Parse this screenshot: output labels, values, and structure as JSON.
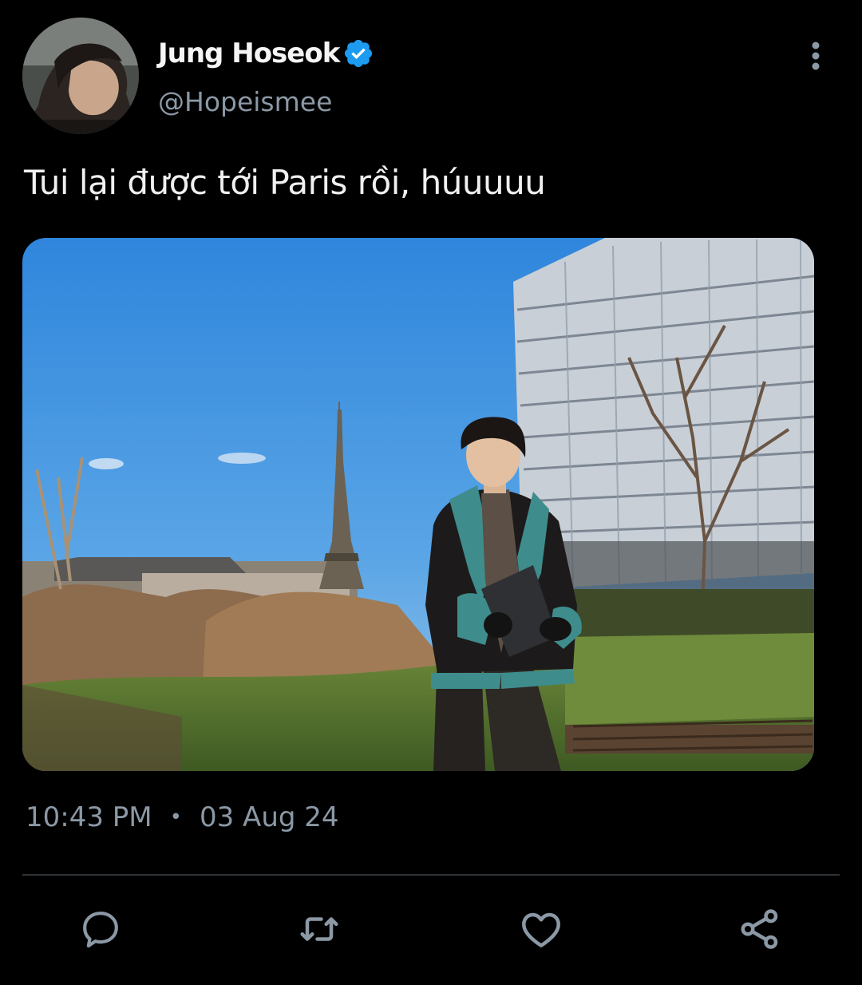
{
  "author": {
    "display_name": "Jung Hoseok",
    "handle": "@Hopeismee",
    "verified_icon": "verified-badge-icon",
    "avatar_icon": "profile-photo"
  },
  "tweet": {
    "text": "Tui lại được tới Paris rồi, húuuuu",
    "time": "10:43 PM",
    "separator": "•",
    "date": "03 Aug 24",
    "image": "photo-eiffel-tower-garden"
  },
  "actions": {
    "reply_icon": "speech-bubble-icon",
    "retweet_icon": "retweet-icon",
    "like_icon": "heart-icon",
    "share_icon": "share-icon"
  },
  "colors": {
    "background": "#000000",
    "text_primary": "#e7e9ea",
    "text_secondary": "#8b98a5",
    "verified_blue": "#1d9bf0",
    "divider": "#2f3336"
  }
}
